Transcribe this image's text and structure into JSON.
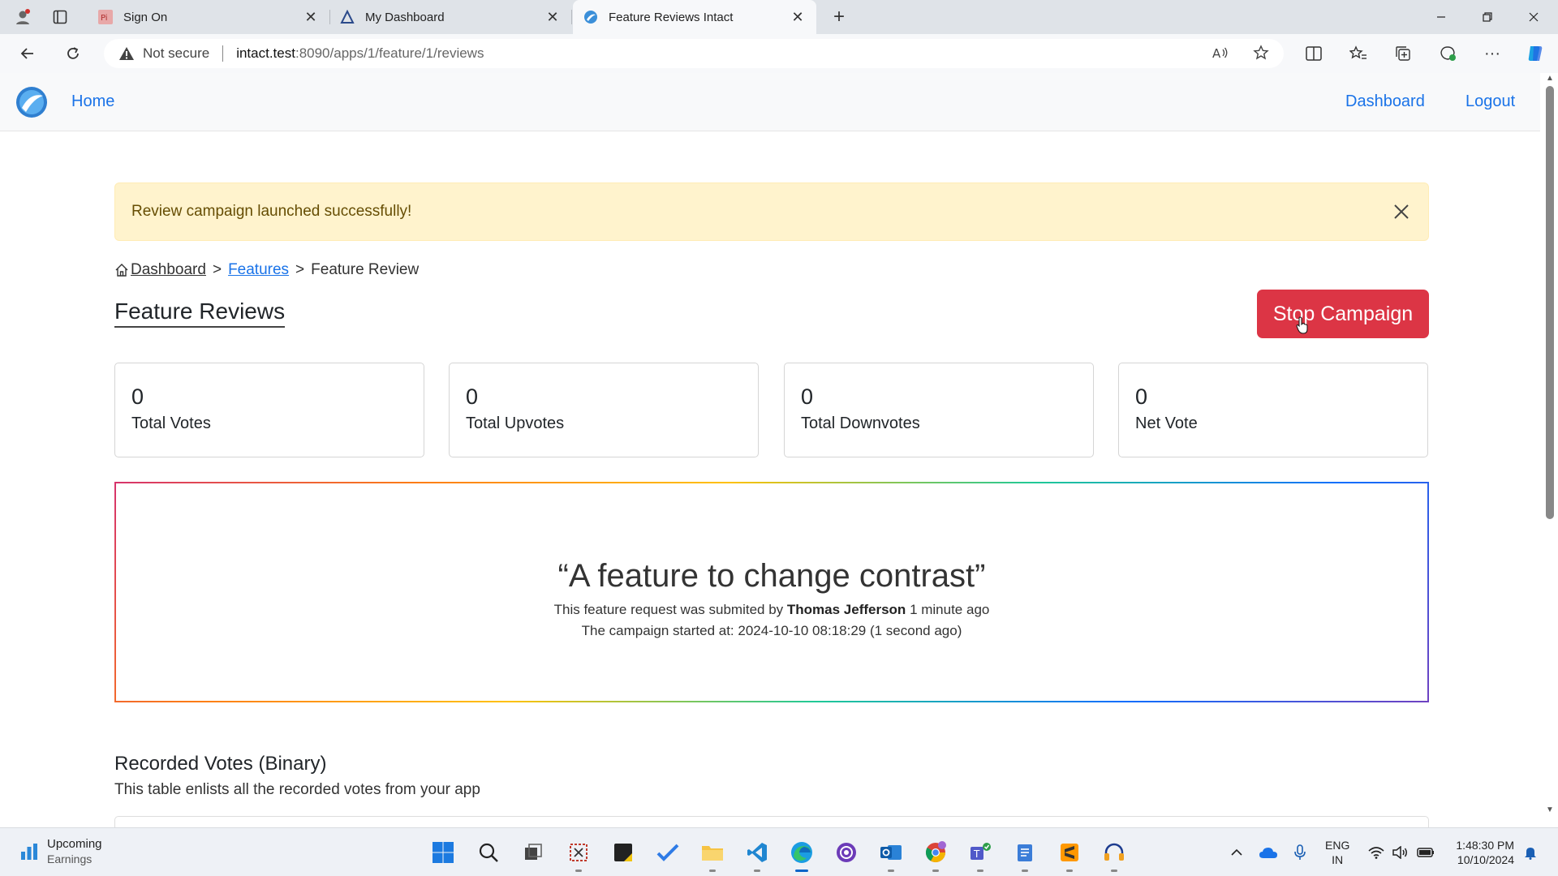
{
  "browser": {
    "tabs": [
      {
        "title": "Sign On",
        "icon": "pi-favicon-icon"
      },
      {
        "title": "My Dashboard",
        "icon": "triangle-favicon-icon"
      },
      {
        "title": "Feature Reviews Intact",
        "icon": "intact-favicon-icon",
        "active": true
      }
    ],
    "address": {
      "security_label": "Not secure",
      "host": "intact.test",
      "path": ":8090/apps/1/feature/1/reviews"
    }
  },
  "nav": {
    "home": "Home",
    "dashboard": "Dashboard",
    "logout": "Logout"
  },
  "alert": {
    "message": "Review campaign launched successfully!"
  },
  "breadcrumb": {
    "dashboard": "Dashboard",
    "sep1": ">",
    "features": "Features",
    "sep2": ">",
    "current": "Feature Review"
  },
  "page": {
    "title": "Feature Reviews",
    "stop_button": "Stop Campaign"
  },
  "stats": [
    {
      "value": "0",
      "label": "Total Votes"
    },
    {
      "value": "0",
      "label": "Total Upvotes"
    },
    {
      "value": "0",
      "label": "Total Downvotes"
    },
    {
      "value": "0",
      "label": "Net Vote"
    }
  ],
  "feature": {
    "quote": "“A feature to change contrast”",
    "submitted_prefix": "This feature request was submited by",
    "author": "Thomas Jefferson",
    "submitted_when": "1 minute ago",
    "campaign_started": "The campaign started at: 2024-10-10 08:18:29 (1 second ago)"
  },
  "votes": {
    "title": "Recorded Votes (Binary)",
    "description": "This table enlists all the recorded votes from your app"
  },
  "taskbar": {
    "weather_title": "Upcoming",
    "weather_sub": "Earnings",
    "lang_line1": "ENG",
    "lang_line2": "IN",
    "time": "1:48:30 PM",
    "date": "10/10/2024"
  },
  "colors": {
    "accent": "#1a73e8",
    "danger": "#dc3545",
    "alert_bg": "#fff3cd"
  }
}
